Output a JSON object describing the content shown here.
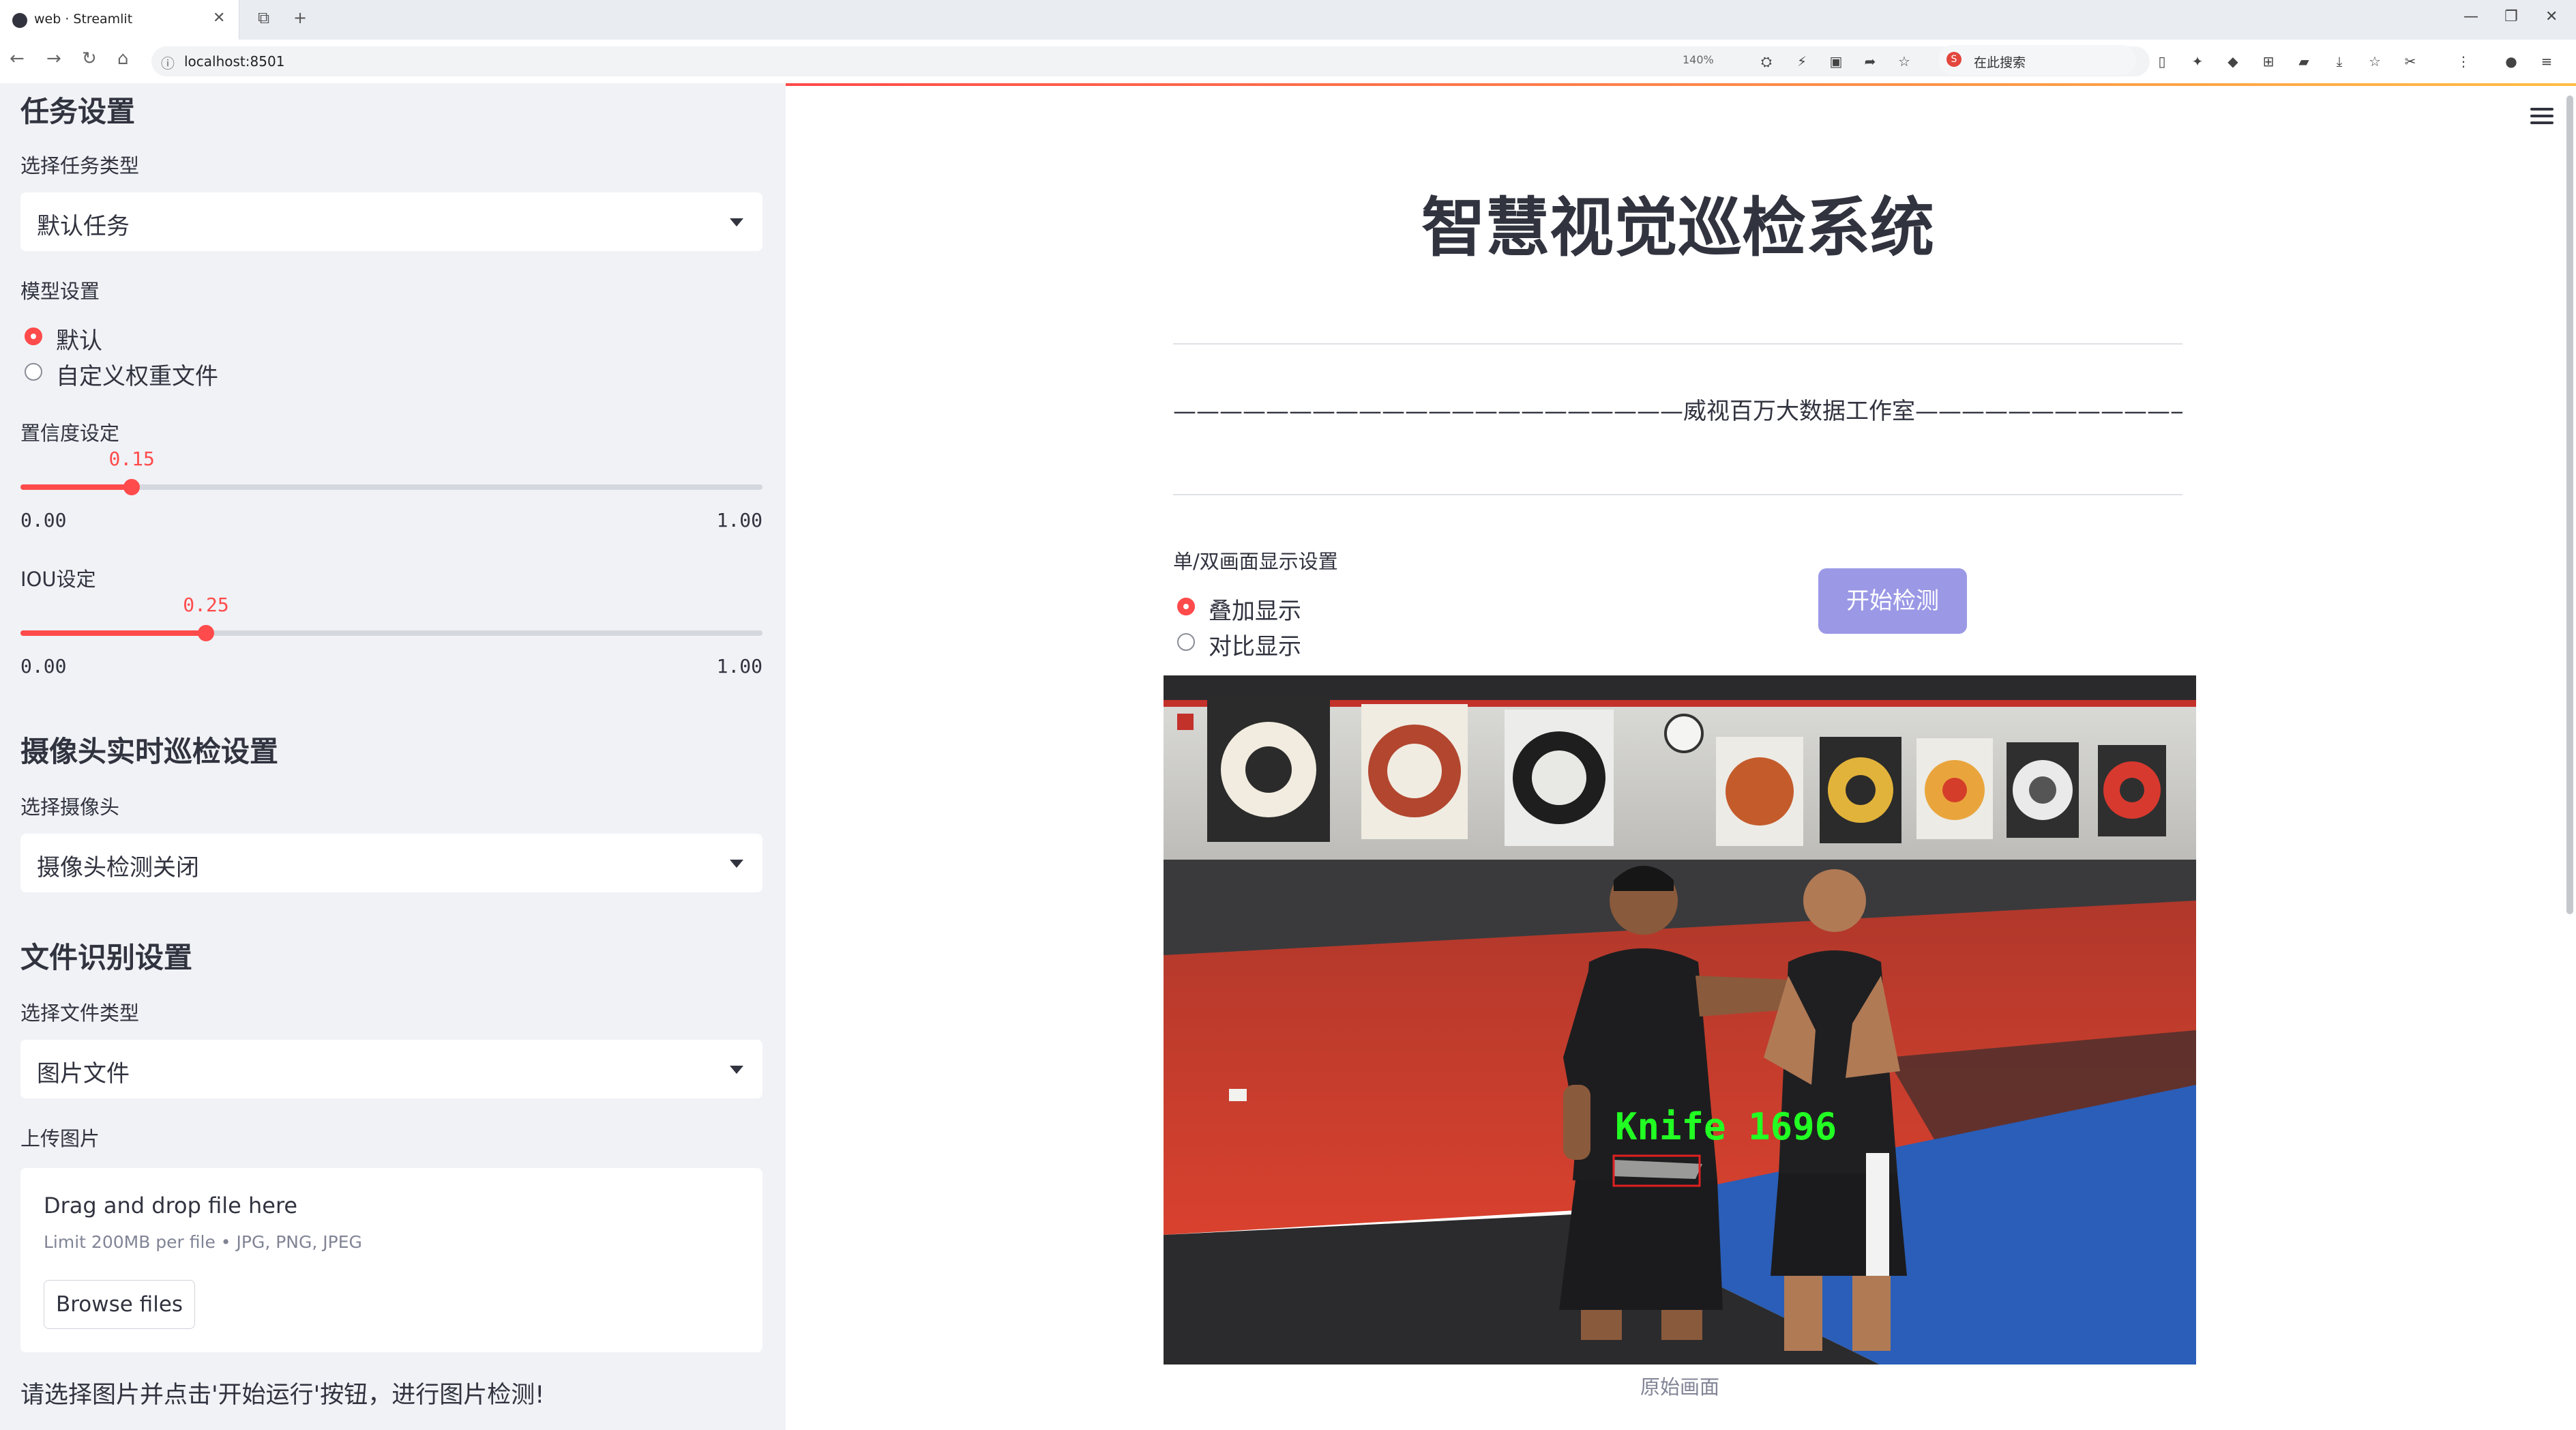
{
  "browser": {
    "tab_title": "web · Streamlit",
    "url": "localhost:8501",
    "zoom": "140%",
    "search_placeholder": "在此搜索"
  },
  "sidebar": {
    "task_heading": "任务设置",
    "task_type_label": "选择任务类型",
    "task_type_value": "默认任务",
    "model_label": "模型设置",
    "model_options": [
      "默认",
      "自定义权重文件"
    ],
    "model_selected": "默认",
    "conf_label": "置信度设定",
    "conf_value": 0.15,
    "conf_value_text": "0.15",
    "conf_min": "0.00",
    "conf_max": "1.00",
    "iou_label": "IOU设定",
    "iou_value": 0.25,
    "iou_value_text": "0.25",
    "iou_min": "0.00",
    "iou_max": "1.00",
    "camera_heading": "摄像头实时巡检设置",
    "camera_label": "选择摄像头",
    "camera_value": "摄像头检测关闭",
    "file_heading": "文件识别设置",
    "file_type_label": "选择文件类型",
    "file_type_value": "图片文件",
    "upload_label": "上传图片",
    "upload_drag": "Drag and drop file here",
    "upload_limit": "Limit 200MB per file • JPG, PNG, JPEG",
    "browse_label": "Browse files",
    "note": "请选择图片并点击'开始运行'按钮，进行图片检测!"
  },
  "main": {
    "title": "智慧视觉巡检系统",
    "studio_line": "——————————————————————威视百万大数据工作室———————————————————————",
    "display_label": "单/双画面显示设置",
    "display_options": [
      "叠加显示",
      "对比显示"
    ],
    "display_selected": "叠加显示",
    "start_button": "开始检测",
    "detection_label": "Knife  1696",
    "image_caption": "原始画面"
  },
  "colors": {
    "accent": "#ff4b4b",
    "sidebar_bg": "#f0f2f6",
    "button_bg": "#9b99e6",
    "detection_text": "#22ff22",
    "detection_box": "#e02020"
  }
}
